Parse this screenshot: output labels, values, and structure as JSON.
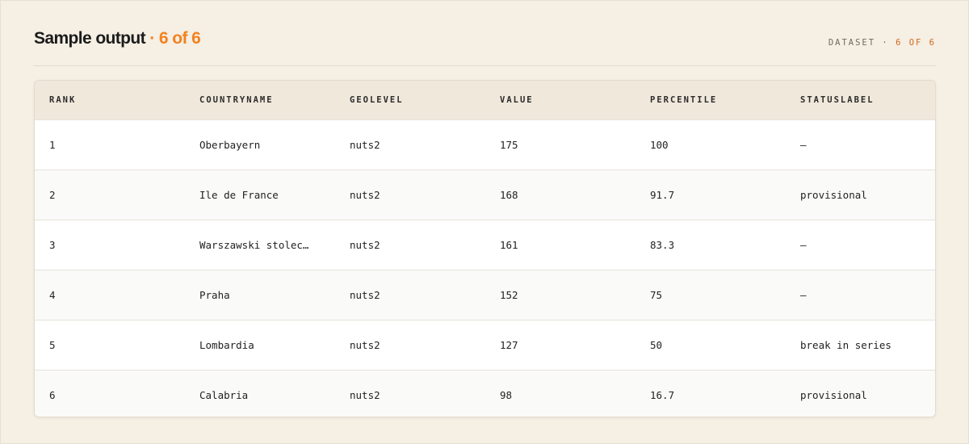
{
  "header": {
    "title_main": "Sample output",
    "title_sep": " · ",
    "title_count": "6 of 6",
    "dataset_label": "DATASET",
    "dataset_sep": " · ",
    "dataset_count": "6 OF 6"
  },
  "table": {
    "columns": [
      "RANK",
      "COUNTRYNAME",
      "GEOLEVEL",
      "VALUE",
      "PERCENTILE",
      "STATUSLABEL"
    ],
    "rows": [
      [
        "1",
        "Oberbayern",
        "nuts2",
        "175",
        "100",
        "—"
      ],
      [
        "2",
        "Ile de France",
        "nuts2",
        "168",
        "91.7",
        "provisional"
      ],
      [
        "3",
        "Warszawski stolec…",
        "nuts2",
        "161",
        "83.3",
        "—"
      ],
      [
        "4",
        "Praha",
        "nuts2",
        "152",
        "75",
        "—"
      ],
      [
        "5",
        "Lombardia",
        "nuts2",
        "127",
        "50",
        "break in series"
      ],
      [
        "6",
        "Calabria",
        "nuts2",
        "98",
        "16.7",
        "provisional"
      ]
    ]
  },
  "colors": {
    "accent": "#f2821f",
    "background": "#f5efe4",
    "header_row": "#f0e8db"
  }
}
